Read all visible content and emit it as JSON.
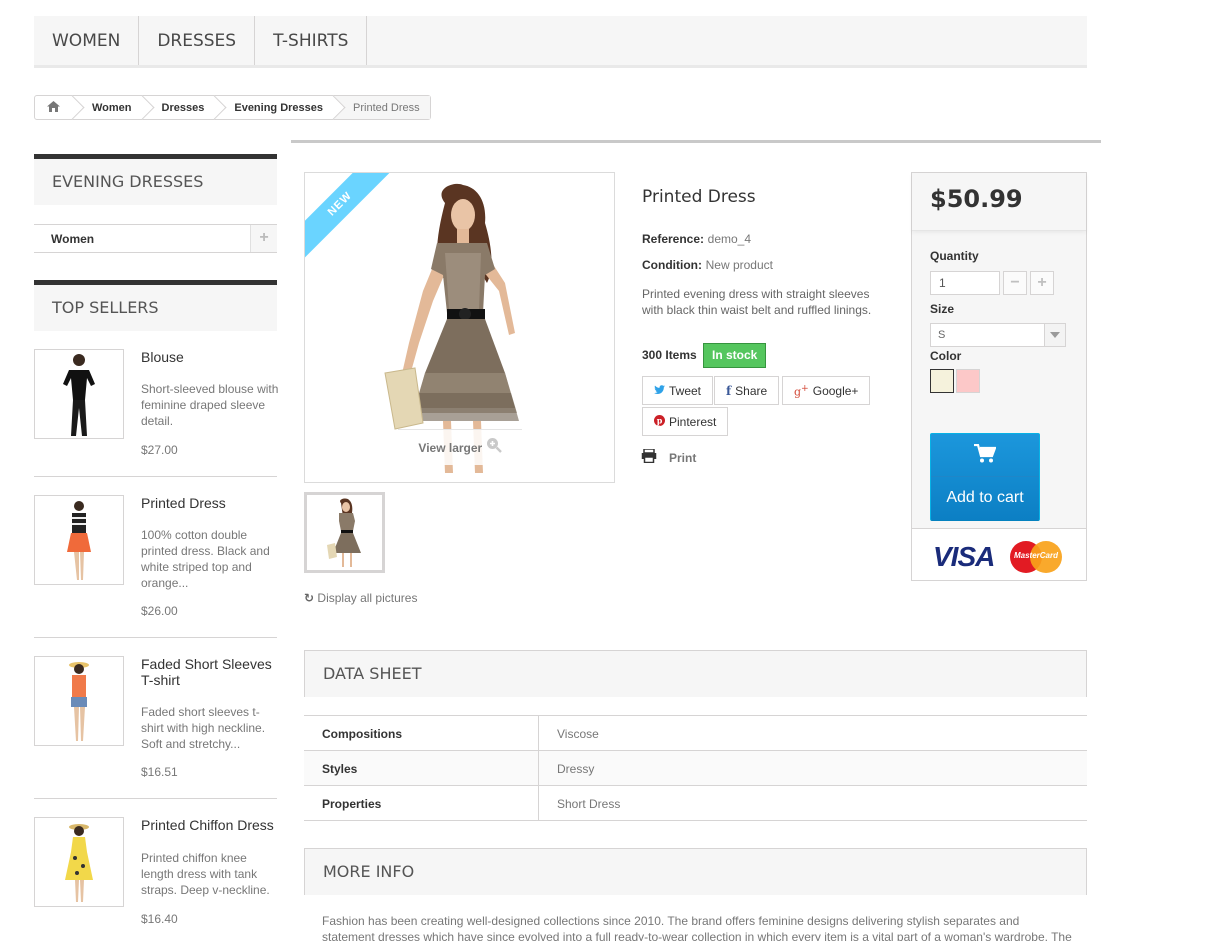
{
  "menu": {
    "items": [
      "Women",
      "Dresses",
      "T-shirts"
    ]
  },
  "breadcrumb": {
    "items": [
      "Women",
      "Dresses",
      "Evening Dresses",
      "Printed Dress"
    ]
  },
  "sidebar": {
    "category_title": "Evening Dresses",
    "category_item": "Women",
    "topsellers_title": "Top sellers",
    "topsellers": [
      {
        "name": "Blouse",
        "desc": "Short-sleeved blouse with feminine draped sleeve detail.",
        "price": "$27.00"
      },
      {
        "name": "Printed Dress",
        "desc": "100% cotton double printed dress. Black and white striped top and orange...",
        "price": "$26.00"
      },
      {
        "name": "Faded Short Sleeves T-shirt",
        "desc": "Faded short sleeves t-shirt with high neckline. Soft and stretchy...",
        "price": "$16.51"
      },
      {
        "name": "Printed Chiffon Dress",
        "desc": "Printed chiffon knee length dress with tank straps. Deep v-neckline.",
        "price": "$16.40"
      }
    ]
  },
  "product": {
    "badge": "New",
    "view_larger": "View larger",
    "display_all": "Display all pictures",
    "title": "Printed Dress",
    "reference_label": "Reference:",
    "reference": "demo_4",
    "condition_label": "Condition:",
    "condition": "New product",
    "description": "Printed evening dress with straight sleeves with black thin waist belt and ruffled linings.",
    "items": "300 Items",
    "stock": "In stock",
    "social": {
      "tweet": "Tweet",
      "share": "Share",
      "google": "Google+",
      "pinterest": "Pinterest"
    },
    "print": "Print"
  },
  "buy": {
    "price": "$50.99",
    "quantity_label": "Quantity",
    "quantity": "1",
    "size_label": "Size",
    "size": "S",
    "color_label": "Color",
    "colors": [
      "#f5f2dc",
      "#fcc8c8"
    ],
    "add_to_cart": "Add to cart",
    "payment": {
      "visa": "VISA",
      "mastercard": "MasterCard"
    }
  },
  "datasheet": {
    "title": "Data sheet",
    "rows": [
      {
        "k": "Compositions",
        "v": "Viscose"
      },
      {
        "k": "Styles",
        "v": "Dressy"
      },
      {
        "k": "Properties",
        "v": "Short Dress"
      }
    ]
  },
  "moreinfo": {
    "title": "More info",
    "text": "Fashion has been creating well-designed collections since 2010. The brand offers feminine designs delivering stylish separates and statement dresses which have since evolved into a full ready-to-wear collection in which every item is a vital part of a woman's wardrobe. The result? Cool,"
  }
}
